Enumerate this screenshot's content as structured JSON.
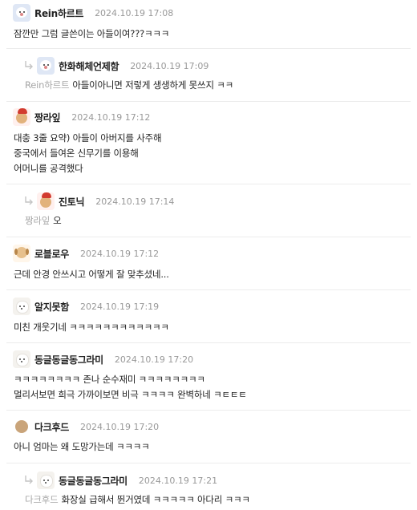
{
  "comments": [
    {
      "nick": "Rein하르트",
      "date": "2024.10.19 17:08",
      "lines": [
        "잠깐만 그럼 글쓴이는 아들이여???ㅋㅋㅋ"
      ]
    },
    {
      "nick": "한화해체언제함",
      "date": "2024.10.19 17:09",
      "mention": "Rein하르트",
      "lines": [
        "아들이아니면 저렇게 생생하게 못쓰지 ㅋㅋ"
      ]
    },
    {
      "nick": "짱라잎",
      "date": "2024.10.19 17:12",
      "lines": [
        "대충 3줄 요약) 아들이 아버지를 사주해",
        "중국에서 들여온 신무기를 이용해",
        "어머니를 공격했다"
      ]
    },
    {
      "nick": "진토닉",
      "date": "2024.10.19 17:14",
      "mention": "짱라잎",
      "lines": [
        "오"
      ]
    },
    {
      "nick": "로블로우",
      "date": "2024.10.19 17:12",
      "lines": [
        "근데 안경 안쓰시고 어떻게 잘 맞추셨네..."
      ]
    },
    {
      "nick": "알지못함",
      "date": "2024.10.19 17:19",
      "lines": [
        "미친 개웃기네 ㅋㅋㅋㅋㅋㅋㅋㅋㅋㅋㅋㅋ"
      ]
    },
    {
      "nick": "동글동글동그라미",
      "date": "2024.10.19 17:20",
      "lines": [
        "ㅋㅋㅋㅋㅋㅋㅋㅋ 존나 순수재미 ㅋㅋㅋㅋㅋㅋㅋㅋ",
        "멀리서보면 희극 가까이보면 비극 ㅋㅋㅋㅋ 완벽하네 ㅋㅌㅌㅌ"
      ]
    },
    {
      "nick": "다크후드",
      "date": "2024.10.19 17:20",
      "lines": [
        "아니 엄마는 왜 도망가는데 ㅋㅋㅋㅋ"
      ]
    },
    {
      "nick": "동글동글동그라미",
      "date": "2024.10.19 17:21",
      "mention": "다크후드",
      "lines": [
        "화장실 급해서 뛴거였데 ㅋㅋㅋㅋㅋ 아다리 ㅋㅋㅋ"
      ]
    }
  ],
  "icons": {
    "avatars": [
      "bear",
      "bear",
      "puppy-red",
      "puppy-red",
      "puppy",
      "white-dog",
      "white-dog",
      "ball",
      "white-dog"
    ],
    "reply": "reply-arrow-icon"
  }
}
